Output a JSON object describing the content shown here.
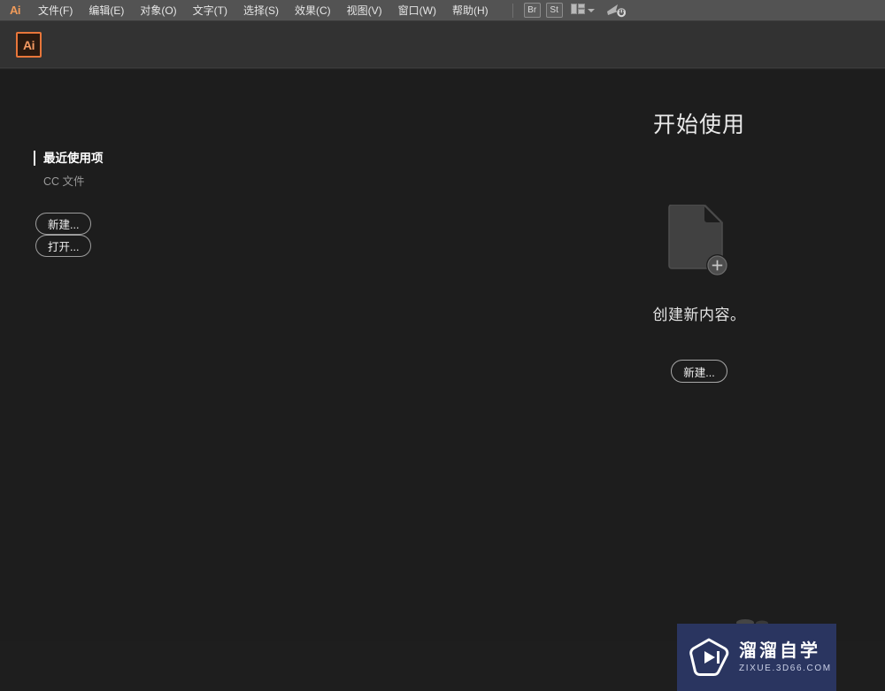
{
  "menubar": {
    "logo": "Ai",
    "logo_icon": "illustrator-logo-icon",
    "items": [
      {
        "label": "文件(F)",
        "name": "menu-file"
      },
      {
        "label": "编辑(E)",
        "name": "menu-edit"
      },
      {
        "label": "对象(O)",
        "name": "menu-object"
      },
      {
        "label": "文字(T)",
        "name": "menu-type"
      },
      {
        "label": "选择(S)",
        "name": "menu-select"
      },
      {
        "label": "效果(C)",
        "name": "menu-effect"
      },
      {
        "label": "视图(V)",
        "name": "menu-view"
      },
      {
        "label": "窗口(W)",
        "name": "menu-window"
      },
      {
        "label": "帮助(H)",
        "name": "menu-help"
      }
    ],
    "bridge_label": "Br",
    "stock_label": "St",
    "workspace_icon": "workspace-grid-icon",
    "workspace_chevron_icon": "chevron-down-icon",
    "search_power_icon": "search-power-icon"
  },
  "appbar": {
    "doc_icon_label": "Ai",
    "doc_icon_name": "illustrator-document-icon"
  },
  "left_rail": {
    "recent_label": "最近使用项",
    "cc_files_label": "CC 文件",
    "new_button": "新建...",
    "open_button": "打开..."
  },
  "start_panel": {
    "title": "开始使用",
    "doc_icon": "new-document-icon",
    "plus_badge_icon": "plus-badge-icon",
    "caption": "创建新内容。",
    "cta_button": "新建..."
  },
  "watermark": {
    "logo_icon": "play-button-logo-icon",
    "name": "溜溜自学",
    "url": "ZIXUE.3D66.COM",
    "background_color": "#2a3560"
  },
  "colors": {
    "menubar_bg": "#535353",
    "appbar_bg": "#323232",
    "stage_bg": "#1d1d1d",
    "accent_orange": "#e8763a",
    "text_primary": "#e9e9e9",
    "text_muted": "#9a9a9a"
  }
}
